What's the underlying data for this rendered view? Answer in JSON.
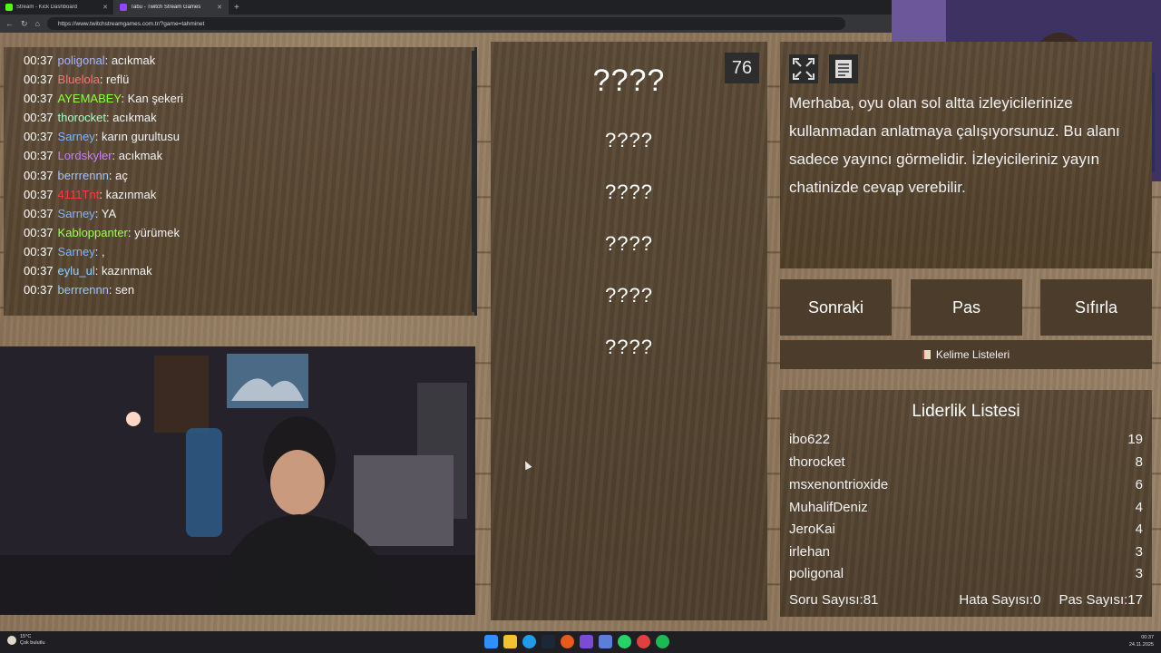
{
  "browser": {
    "tabs": [
      {
        "title": "Stream - Kick Dashboard",
        "active": false
      },
      {
        "title": "Tabu - Twitch Stream Games",
        "active": true
      }
    ],
    "url": "https://www.twitchstreamgames.com.tr/?game=tahminet"
  },
  "chat": {
    "messages": [
      {
        "time": "00:37",
        "user": "poligonal",
        "color": "#9fb7ff",
        "text": "acıkmak"
      },
      {
        "time": "00:37",
        "user": "Bluelola",
        "color": "#ff6f7a",
        "text": "reflü"
      },
      {
        "time": "00:37",
        "user": "AYEMABEY",
        "color": "#8aff3a",
        "text": "Kan şekeri"
      },
      {
        "time": "00:37",
        "user": "thorocket",
        "color": "#a6ffc8",
        "text": "acıkmak"
      },
      {
        "time": "00:37",
        "user": "Sarney",
        "color": "#7fb4ff",
        "text": "karın gurultusu"
      },
      {
        "time": "00:37",
        "user": "Lordskyler",
        "color": "#c77dff",
        "text": "acıkmak"
      },
      {
        "time": "00:37",
        "user": "berrrennn",
        "color": "#a0c4ff",
        "text": "aç"
      },
      {
        "time": "00:37",
        "user": "4111Tnt",
        "color": "#ff3b3b",
        "text": "kazınmak"
      },
      {
        "time": "00:37",
        "user": "Sarney",
        "color": "#7fb4ff",
        "text": "YA"
      },
      {
        "time": "00:37",
        "user": "Kabloppanter",
        "color": "#9cff5a",
        "text": "yürümek"
      },
      {
        "time": "00:37",
        "user": "Sarney",
        "color": "#7fb4ff",
        "text": ","
      },
      {
        "time": "00:37",
        "user": "eylu_ul",
        "color": "#8fd3ff",
        "text": "kazınmak"
      },
      {
        "time": "00:37",
        "user": "berrrennn",
        "color": "#a0c4ff",
        "text": "sen"
      }
    ]
  },
  "game": {
    "timer": "76",
    "words": [
      "????",
      "????",
      "????",
      "????",
      "????",
      "????"
    ]
  },
  "info": {
    "text": "Merhaba, oyu olan sol altta izleyicilerinize kullanmadan anlatmaya çalışıyorsunuz. Bu alanı sadece yayıncı görmelidir. İzleyicileriniz yayın chatinizde cevap verebilir."
  },
  "buttons": {
    "next": "Sonraki",
    "pass": "Pas",
    "reset": "Sıfırla",
    "word_lists": "Kelime Listeleri"
  },
  "leaderboard": {
    "title": "Liderlik Listesi",
    "rows": [
      {
        "name": "ibo622",
        "score": "19"
      },
      {
        "name": "thorocket",
        "score": "8"
      },
      {
        "name": "msxenontrioxide",
        "score": "6"
      },
      {
        "name": "MuhalifDeniz",
        "score": "4"
      },
      {
        "name": "JeroKai",
        "score": "4"
      },
      {
        "name": "irlehan",
        "score": "3"
      },
      {
        "name": "poligonal",
        "score": "3"
      }
    ],
    "stats": {
      "questions": "Soru Sayısı:81",
      "errors": "Hata Sayısı:0",
      "passes": "Pas Sayısı:17"
    }
  },
  "taskbar": {
    "weather_temp": "15°C",
    "weather_desc": "Çok bulutlu",
    "time": "00:37",
    "date": "24.11.2025"
  }
}
